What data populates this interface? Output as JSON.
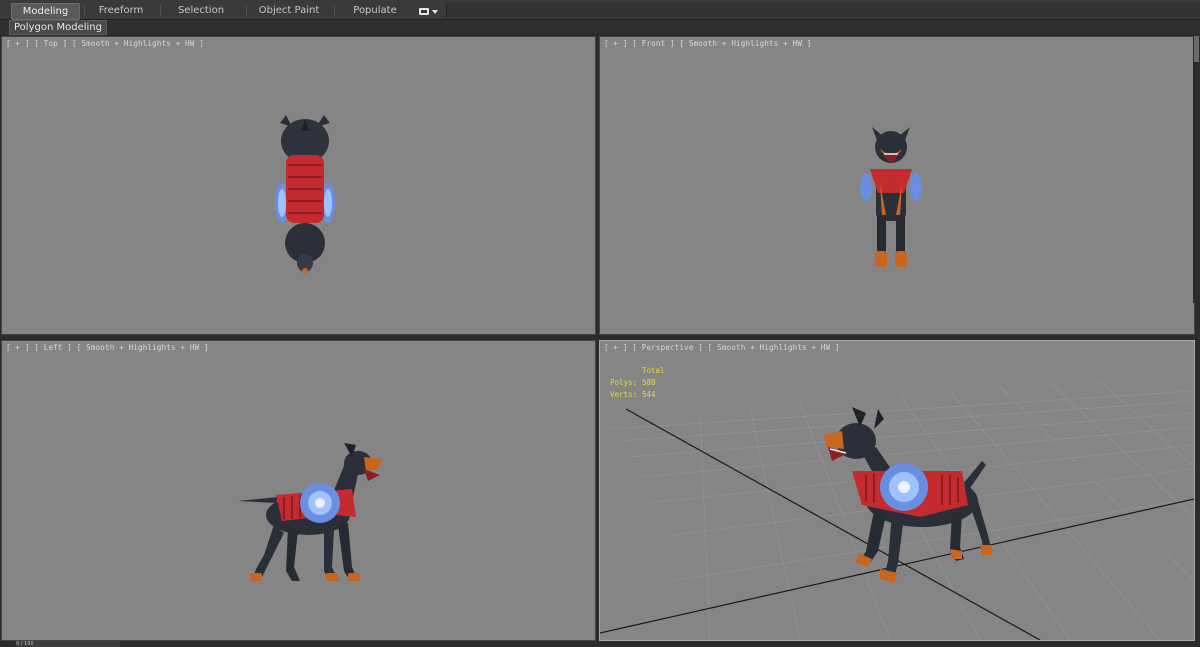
{
  "ribbon": {
    "tabs": [
      {
        "label": "Modeling",
        "active": true
      },
      {
        "label": "Freeform",
        "active": false
      },
      {
        "label": "Selection",
        "active": false
      },
      {
        "label": "Object Paint",
        "active": false
      },
      {
        "label": "Populate",
        "active": false
      }
    ],
    "options_icon": "ribbon-options-icon",
    "subtab": "Polygon Modeling"
  },
  "viewports": {
    "top": {
      "label": "[ + ] [ Top ] [ Smooth + Highlights + HW ]"
    },
    "front": {
      "label": "[ + ] [ Front ] [ Smooth + Highlights + HW ]"
    },
    "left": {
      "label": "[ + ] [ Left ] [ Smooth + Highlights + HW ]"
    },
    "perspective": {
      "label": "[ + ] [ Perspective ] [ Smooth + Highlights + HW ]",
      "stats": {
        "header": "Total",
        "polys_label": "Polys:",
        "polys_value": "580",
        "verts_label": "Verts:",
        "verts_value": "544"
      }
    }
  },
  "status": {
    "frame_text": "0 / 100"
  },
  "colors": {
    "viewport_bg": "#858585",
    "stats_text": "#e7dc39",
    "dog_body": "#2a2e38",
    "dog_tan": "#c8651e",
    "vest_red": "#c42b2e",
    "shield_blue": "#6a8fe0"
  }
}
